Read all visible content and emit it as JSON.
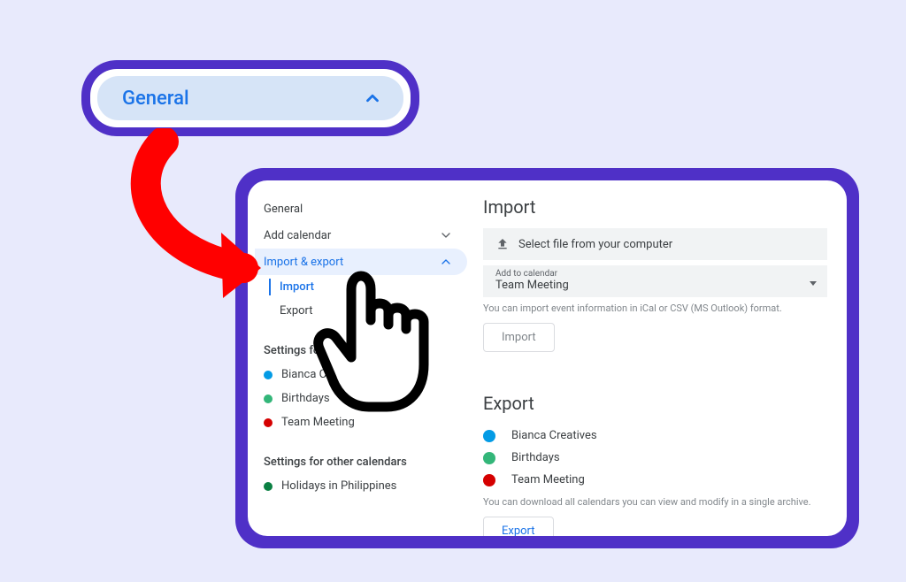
{
  "general_bubble": {
    "label": "General"
  },
  "sidebar": {
    "nav": {
      "general": "General",
      "add_calendar": "Add calendar",
      "import_export": "Import & export",
      "import": "Import",
      "export": "Export"
    },
    "section_my": "Settings for my calendars",
    "section_other": "Settings for other calendars",
    "my_calendars": [
      {
        "label": "Bianca Creatives",
        "color": "#039be5"
      },
      {
        "label": "Birthdays",
        "color": "#33b679"
      },
      {
        "label": "Team Meeting",
        "color": "#d50000"
      }
    ],
    "other_calendars": [
      {
        "label": "Holidays in Philippines",
        "color": "#0b8043"
      }
    ]
  },
  "import_panel": {
    "heading": "Import",
    "select_file_label": "Select file from your computer",
    "add_to_label": "Add to calendar",
    "add_to_value": "Team Meeting",
    "help": "You can import event information in iCal or CSV (MS Outlook) format.",
    "button": "Import"
  },
  "export_panel": {
    "heading": "Export",
    "calendars": [
      {
        "label": "Bianca Creatives",
        "color": "#039be5"
      },
      {
        "label": "Birthdays",
        "color": "#33b679"
      },
      {
        "label": "Team Meeting",
        "color": "#d50000"
      }
    ],
    "help": "You can download all calendars you can view and modify in a single archive.",
    "button": "Export"
  }
}
